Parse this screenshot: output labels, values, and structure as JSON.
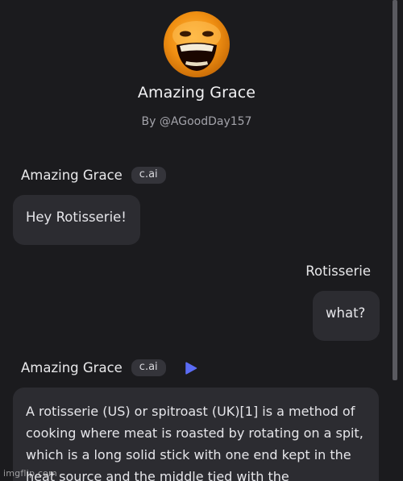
{
  "character": {
    "name": "Amazing Grace",
    "author": "By @AGoodDay157"
  },
  "messages": [
    {
      "sender": "Amazing Grace",
      "badge": "c.ai",
      "text": "Hey Rotisserie!"
    },
    {
      "sender": "Rotisserie",
      "text": "what?"
    },
    {
      "sender": "Amazing Grace",
      "badge": "c.ai",
      "text": "A rotisserie (US) or spitroast (UK)[1] is a method of cooking where meat is roasted by rotating on a spit, which is a long solid stick with one end kept in the heat source and the middle tied with the"
    }
  ],
  "icons": {
    "play": "play-icon",
    "avatar": "laughing-orange-avatar"
  },
  "colors": {
    "background": "#1b1b1e",
    "bubble": "#2c2c31",
    "badge": "#34343a",
    "accent": "#5b6cf5"
  },
  "watermark": "imgflip.com"
}
